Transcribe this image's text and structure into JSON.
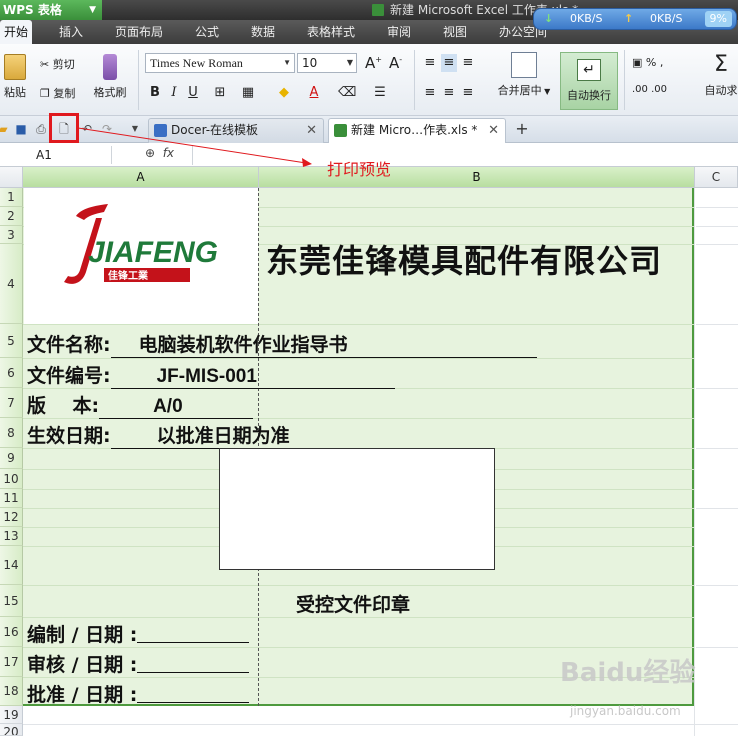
{
  "titlebar": {
    "app_name": "WPS 表格",
    "window_title": "新建 Microsoft Excel 工作表.xls *"
  },
  "net_widget": {
    "down": "0KB/S",
    "up": "0KB/S",
    "percent": "9%"
  },
  "menu": {
    "tabs": [
      "开始",
      "插入",
      "页面布局",
      "公式",
      "数据",
      "表格样式",
      "审阅",
      "视图",
      "办公空间"
    ]
  },
  "ribbon": {
    "paste": "粘贴",
    "cut": "剪切",
    "copy": "复制",
    "format_painter": "格式刷",
    "font_name": "Times New Roman",
    "font_size": "10",
    "merge_center": "合并居中",
    "wrap_text": "自动换行",
    "auto_sum": "自动求"
  },
  "doc_tabs": [
    {
      "label": "Docer-在线模板"
    },
    {
      "label": "新建 Micro…作表.xls *"
    }
  ],
  "formula_bar": {
    "cell_ref": "A1",
    "fx": "fx"
  },
  "annotation": "打印预览",
  "columns": [
    "A",
    "B",
    "C"
  ],
  "rows": [
    "1",
    "2",
    "3",
    "4",
    "5",
    "6",
    "7",
    "8",
    "9",
    "10",
    "11",
    "12",
    "13",
    "14",
    "15",
    "16",
    "17",
    "18",
    "19",
    "20"
  ],
  "sheet": {
    "logo_text": "JIAFENG",
    "logo_sub": "佳锋工業",
    "company": "东莞佳锋模具配件有限公司",
    "fields": [
      {
        "label": "文件名称:",
        "value": "电脑装机软件作业指导书"
      },
      {
        "label": "文件编号:",
        "value": "JF-MIS-001"
      },
      {
        "label": "版    本:",
        "value": "A/0"
      },
      {
        "label": "生效日期:",
        "value": "以批准日期为准"
      }
    ],
    "stamp_label": "受控文件印章",
    "signoffs": [
      "编制 / 日期 :",
      "审核 / 日期 :",
      "批准 / 日期 :"
    ]
  },
  "watermark": {
    "main": "Baidu经验",
    "sub": "jingyan.baidu.com"
  }
}
